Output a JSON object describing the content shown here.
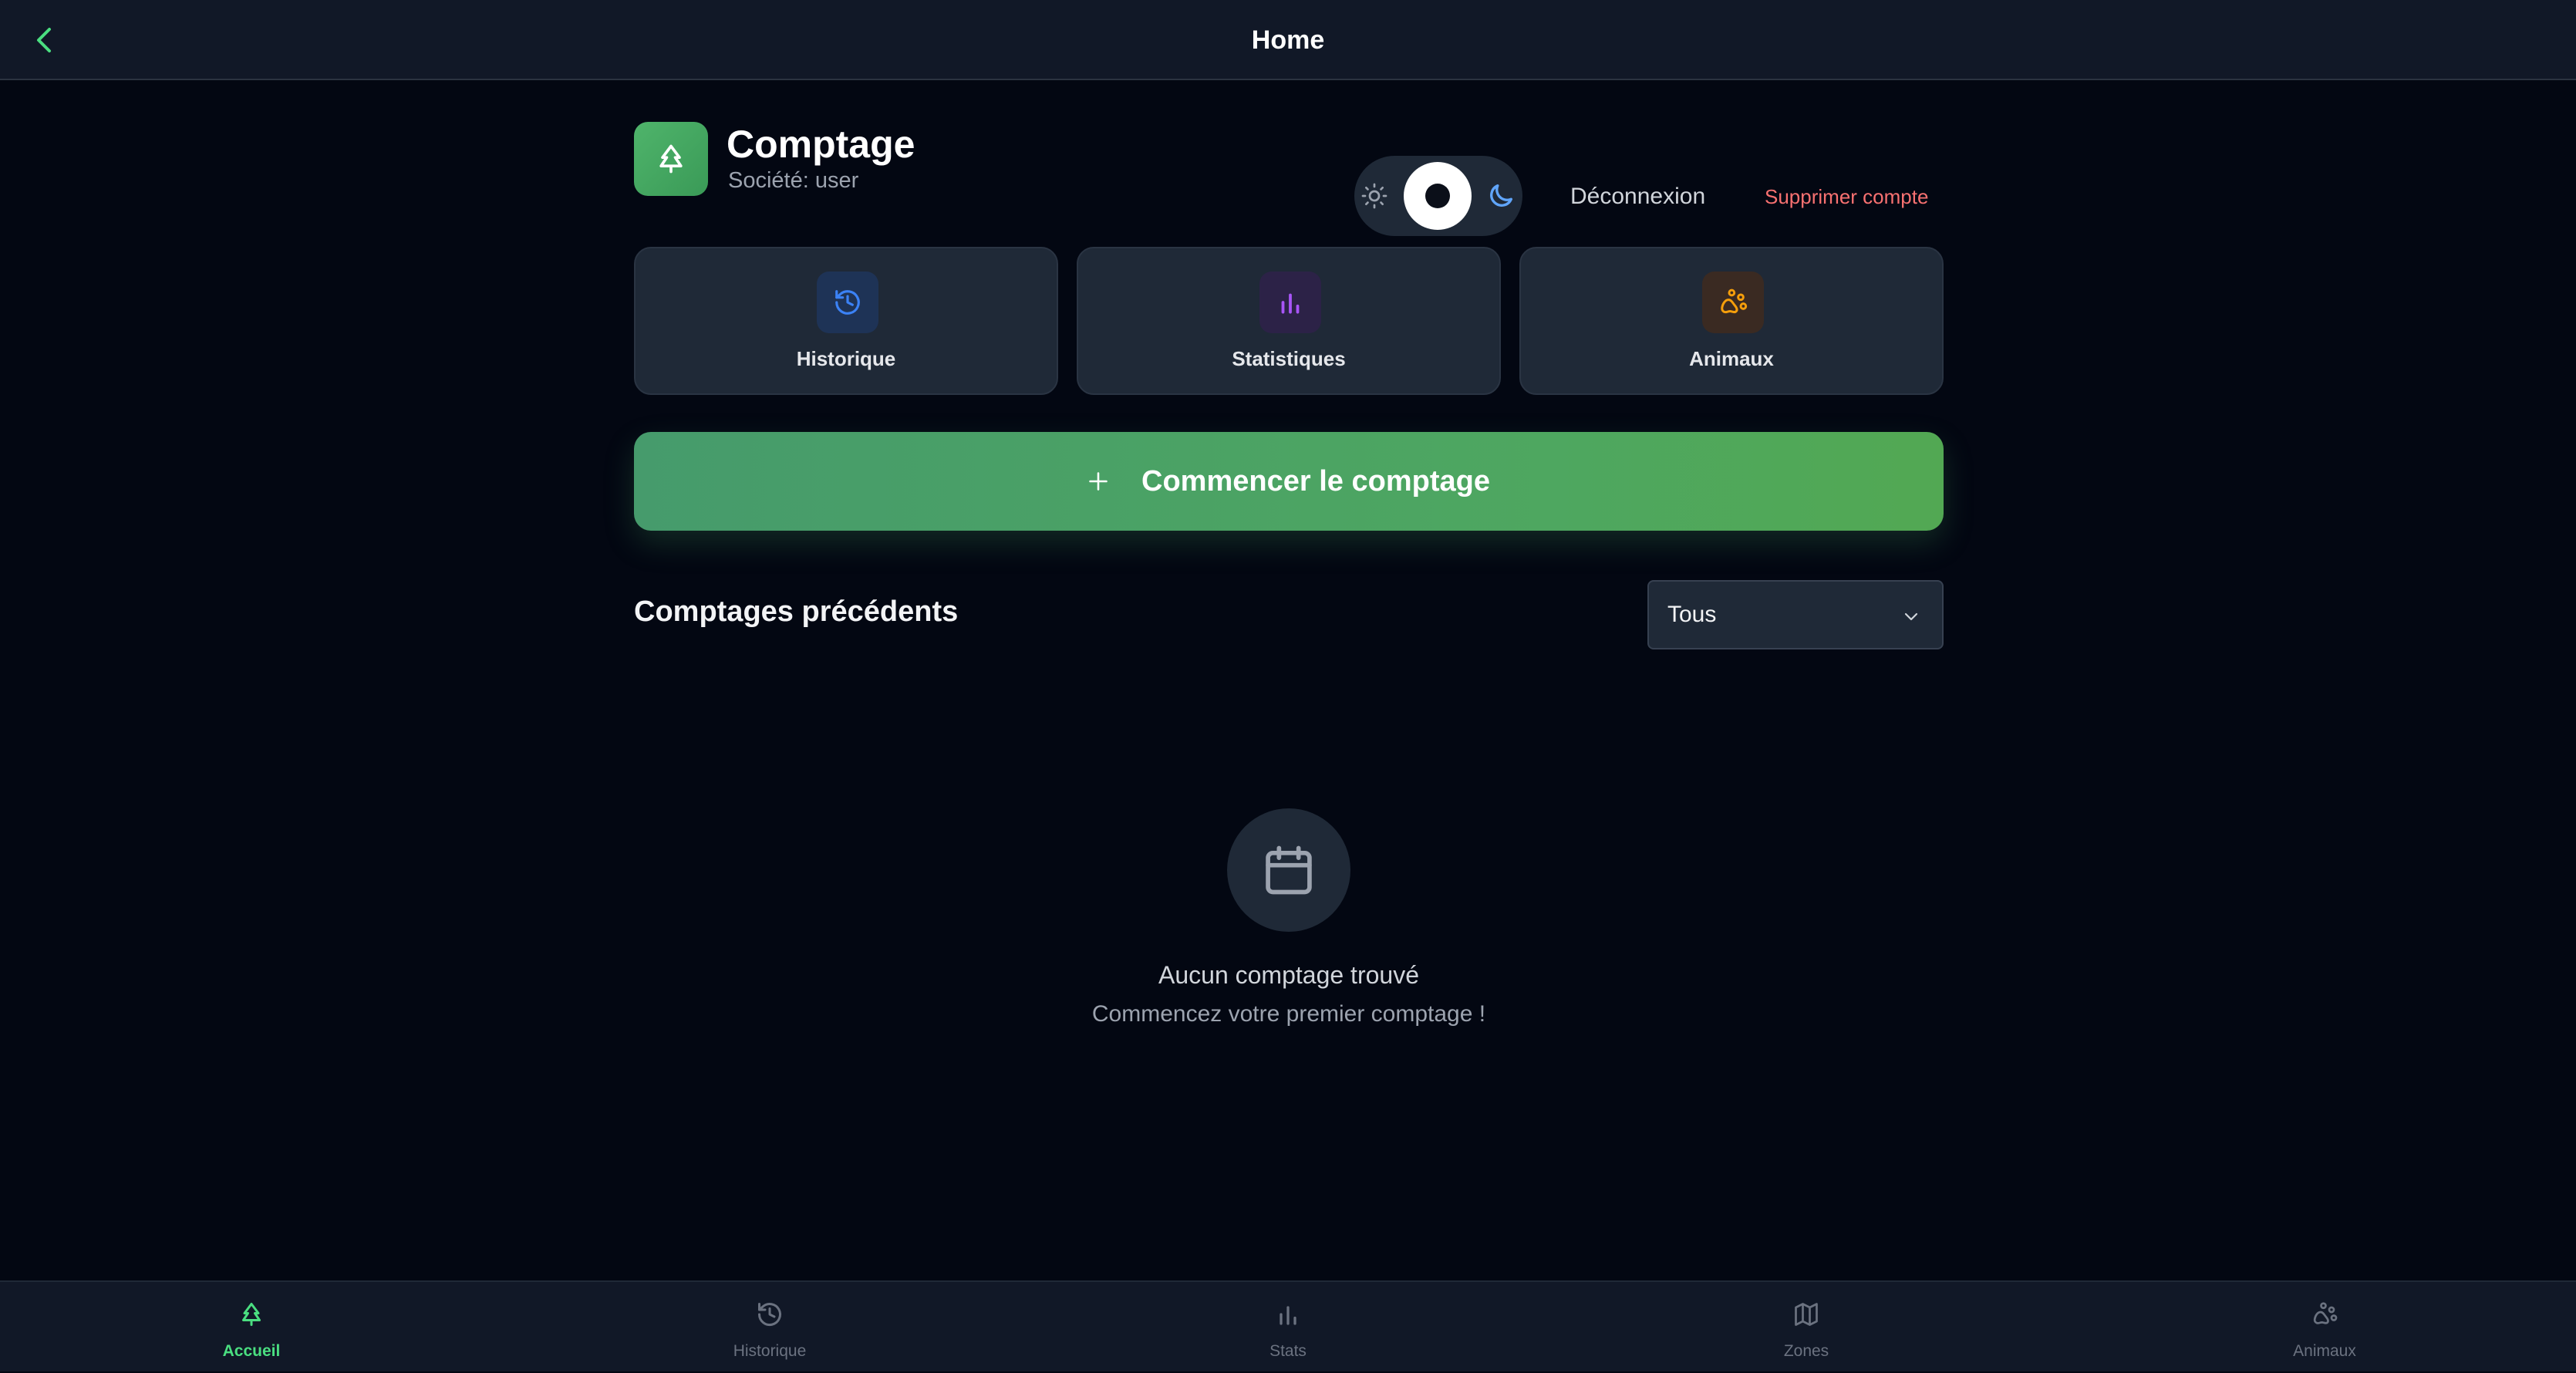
{
  "topbar": {
    "title": "Home"
  },
  "app": {
    "title": "Comptage",
    "subtitle": "Société: user"
  },
  "actions": {
    "logout": "Déconnexion",
    "delete_account": "Supprimer compte"
  },
  "theme": {
    "mode": "dark"
  },
  "cards": [
    {
      "label": "Historique",
      "icon": "history-icon",
      "color": "#3b82f6",
      "bg": "#1e3a5f"
    },
    {
      "label": "Statistiques",
      "icon": "bar-chart-icon",
      "color": "#a855f7",
      "bg": "#2e2248"
    },
    {
      "label": "Animaux",
      "icon": "paw-icon",
      "color": "#f59e0b",
      "bg": "#3a2a20"
    }
  ],
  "start_button": {
    "label": "Commencer le comptage"
  },
  "previous": {
    "title": "Comptages précédents",
    "filter": {
      "selected": "Tous"
    }
  },
  "empty_state": {
    "title": "Aucun comptage trouvé",
    "subtitle": "Commencez votre premier comptage !"
  },
  "bottom_nav": [
    {
      "label": "Accueil",
      "icon": "tree-icon",
      "active": true
    },
    {
      "label": "Historique",
      "icon": "history-icon",
      "active": false
    },
    {
      "label": "Stats",
      "icon": "bar-chart-icon",
      "active": false
    },
    {
      "label": "Zones",
      "icon": "map-icon",
      "active": false
    },
    {
      "label": "Animaux",
      "icon": "paw-icon",
      "active": false
    }
  ],
  "colors": {
    "accent": "#4ade80",
    "danger": "#f87171",
    "background": "#030712",
    "surface": "#1f2937"
  }
}
